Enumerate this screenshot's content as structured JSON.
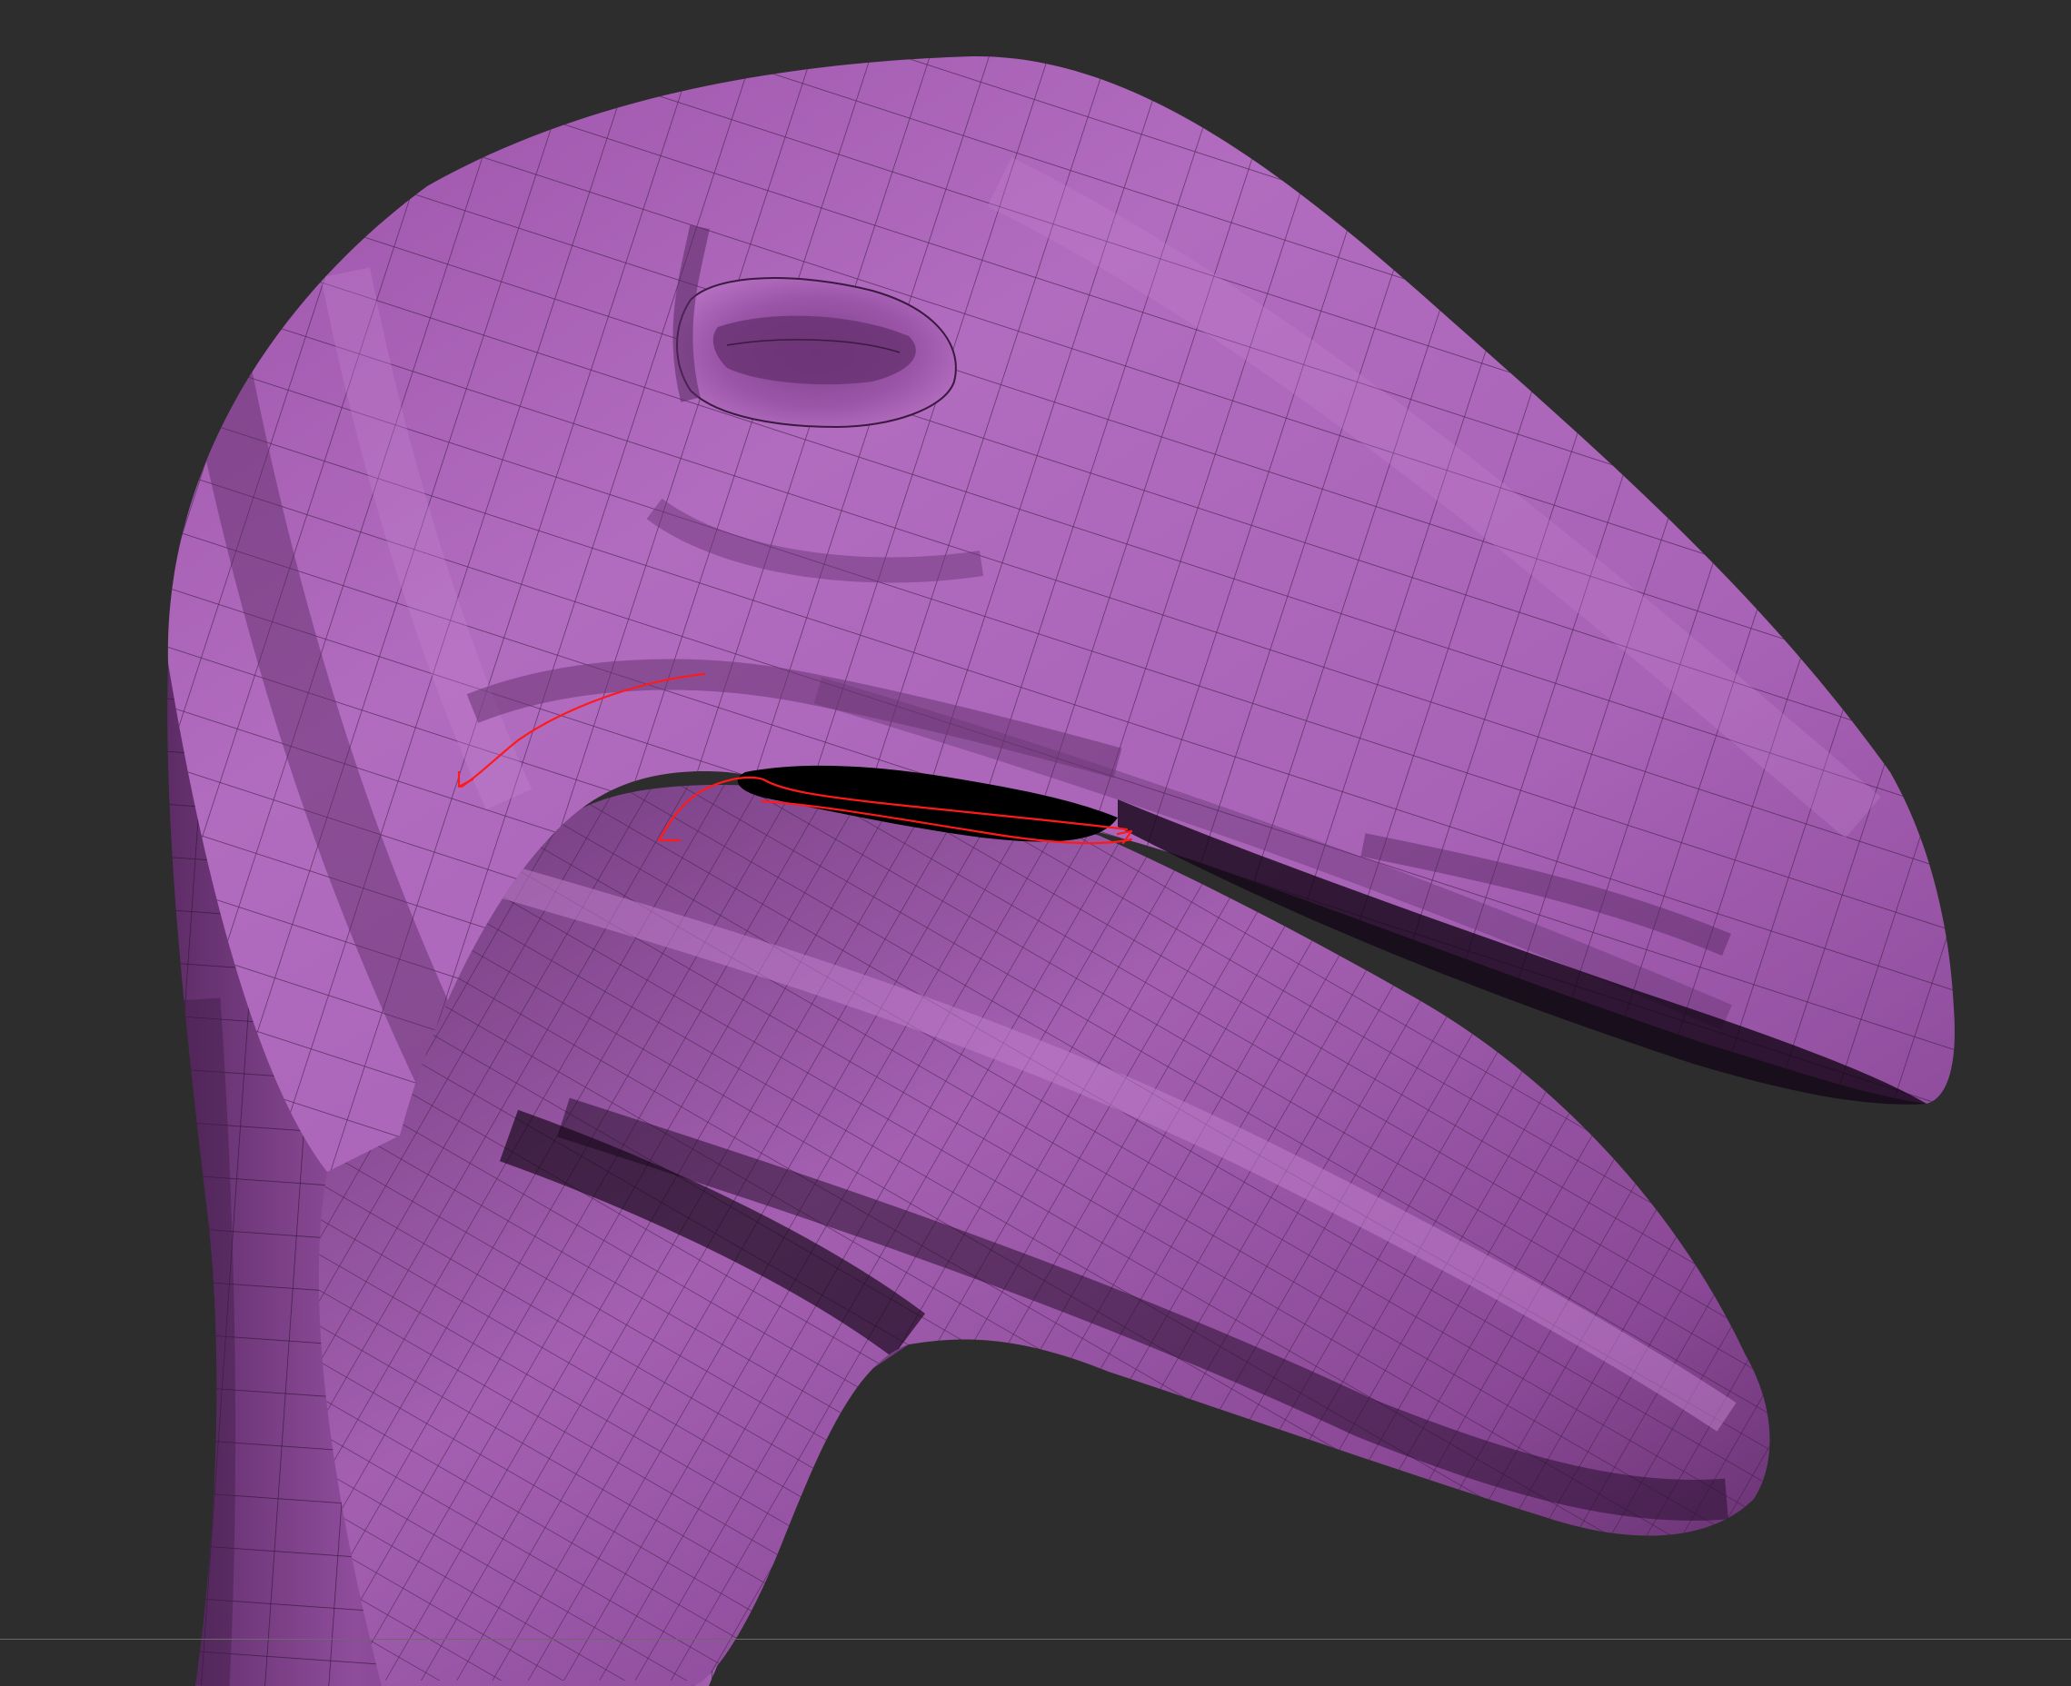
{
  "viewport": {
    "background_color": "#2d2d2d",
    "floor_line_color": "#6a6a6a"
  },
  "model": {
    "subject": "bird-head-mesh",
    "base_color": "#a760b4",
    "highlight_color": "#bd78c8",
    "shadow_color": "#6a3571",
    "deep_shadow_color": "#2a1030",
    "wireframe_color": "#3a1a40",
    "mouth_gap_color": "#000000"
  },
  "annotations": {
    "stroke_color": "#ff1a1a",
    "strokes": [
      "arrow-upper-lip-curve",
      "arrow-mouth-corner-curve"
    ]
  }
}
